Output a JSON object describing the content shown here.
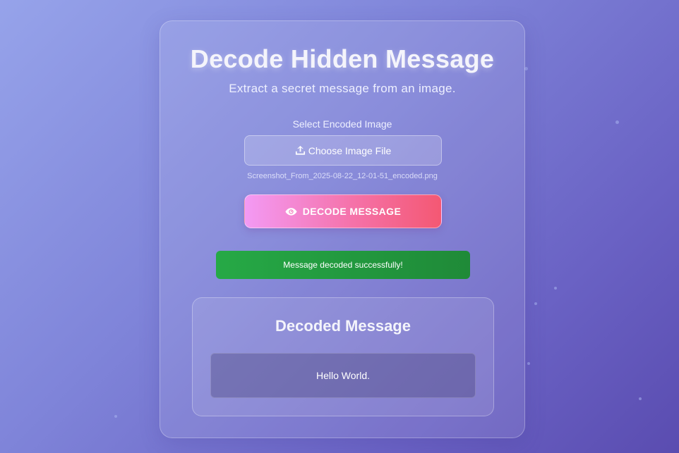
{
  "header": {
    "title": "Decode Hidden Message",
    "subtitle": "Extract a secret message from an image."
  },
  "upload": {
    "label": "Select Encoded Image",
    "button_label": "Choose Image File",
    "button_icon": "upload-icon",
    "selected_file": "Screenshot_From_2025-08-22_12-01-51_encoded.png"
  },
  "decode": {
    "button_label": "DECODE MESSAGE",
    "button_icon": "eye-icon"
  },
  "status": {
    "message": "Message decoded successfully!",
    "color": "#26a946"
  },
  "result": {
    "title": "Decoded Message",
    "message": "Hello World."
  },
  "colors": {
    "background_start": "#96a3ea",
    "background_end": "#5a4cb0",
    "decode_button_start": "#f39af4",
    "decode_button_end": "#f45873"
  }
}
